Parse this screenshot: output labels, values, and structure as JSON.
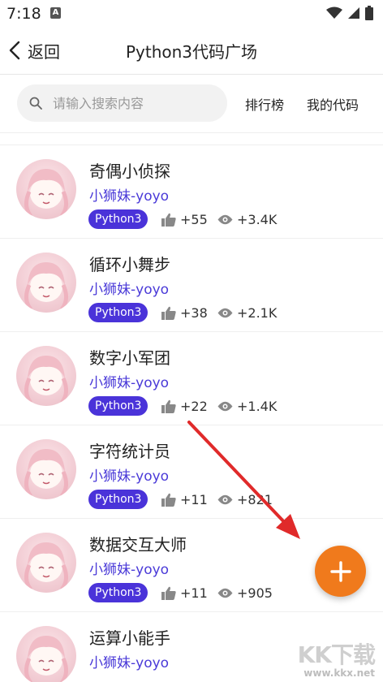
{
  "status_bar": {
    "time": "7:18",
    "notification_badge": "A"
  },
  "nav": {
    "back_label": "返回",
    "title": "Python3代码广场"
  },
  "search": {
    "placeholder": "请输入搜索内容",
    "ranking_label": "排行榜",
    "my_code_label": "我的代码"
  },
  "items": [
    {
      "title": "奇偶小侦探",
      "author": "小狮妹-yoyo",
      "tag": "Python3",
      "likes": "+55",
      "views": "+3.4K"
    },
    {
      "title": "循环小舞步",
      "author": "小狮妹-yoyo",
      "tag": "Python3",
      "likes": "+38",
      "views": "+2.1K"
    },
    {
      "title": "数字小军团",
      "author": "小狮妹-yoyo",
      "tag": "Python3",
      "likes": "+22",
      "views": "+1.4K"
    },
    {
      "title": "字符统计员",
      "author": "小狮妹-yoyo",
      "tag": "Python3",
      "likes": "+11",
      "views": "+821"
    },
    {
      "title": "数据交互大师",
      "author": "小狮妹-yoyo",
      "tag": "Python3",
      "likes": "+11",
      "views": "+905"
    },
    {
      "title": "运算小能手",
      "author": "小狮妹-yoyo",
      "tag": "Python3",
      "likes": "",
      "views": ""
    }
  ],
  "fab": {
    "icon": "plus-icon"
  },
  "watermark": {
    "brand": "KK下载",
    "url": "www.kkx.net"
  },
  "colors": {
    "accent": "#4a33d9",
    "author": "#4a3ad8",
    "fab": "#f07a1c",
    "arrow": "#e02a2a"
  }
}
